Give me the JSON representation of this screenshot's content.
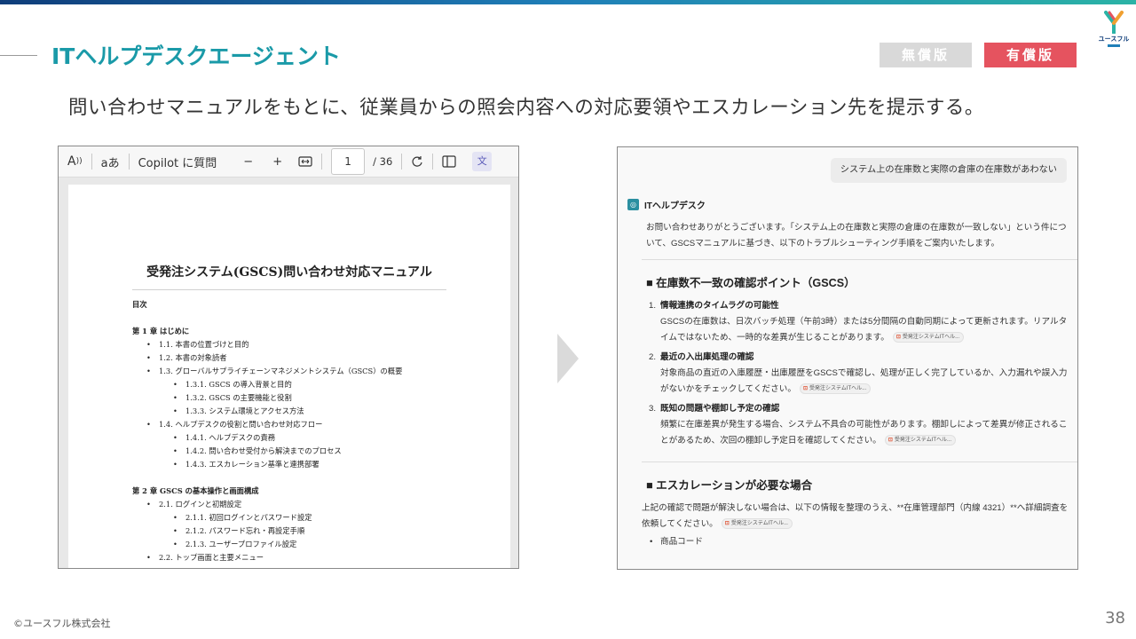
{
  "slide": {
    "title": "ITヘルプデスクエージェント",
    "subtitle": "問い合わせマニュアルをもとに、従業員からの照会内容への対応要領やエスカレーション先を提示する。",
    "badges": {
      "free": "無償版",
      "paid": "有償版"
    },
    "logo_text": "ユースフル",
    "copyright": "©ユースフル株式会社",
    "page_number": "38"
  },
  "pdf_viewer": {
    "toolbar": {
      "read_aloud_label": "A",
      "text_label": "aあ",
      "copilot_label": "Copilot に質問",
      "zoom_out_label": "−",
      "zoom_in_label": "+",
      "current_page": "1",
      "total_pages": "/ 36"
    },
    "document": {
      "title": "受発注システム(GSCS)問い合わせ対応マニュアル",
      "toc_heading": "目次",
      "chapter1": "第 1 章 はじめに",
      "c1_1": "1.1. 本書の位置づけと目的",
      "c1_2": "1.2. 本書の対象読者",
      "c1_3": "1.3. グローバルサプライチェーンマネジメントシステム（GSCS）の概要",
      "c1_3_1": "1.3.1. GSCS の導入背景と目的",
      "c1_3_2": "1.3.2. GSCS の主要機能と役割",
      "c1_3_3": "1.3.3. システム環境とアクセス方法",
      "c1_4": "1.4. ヘルプデスクの役割と問い合わせ対応フロー",
      "c1_4_1": "1.4.1. ヘルプデスクの責務",
      "c1_4_2": "1.4.2. 問い合わせ受付から解決までのプロセス",
      "c1_4_3": "1.4.3. エスカレーション基準と連携部署",
      "chapter2": "第 2 章 GSCS の基本操作と画面構成",
      "c2_1": "2.1. ログインと初期設定",
      "c2_1_1": "2.1.1. 初回ログインとパスワード設定",
      "c2_1_2": "2.1.2. パスワード忘れ・再設定手順",
      "c2_1_3": "2.1.3. ユーザープロファイル設定",
      "c2_2": "2.2. トップ画面と主要メニュー"
    }
  },
  "chat": {
    "user_message": "システム上の在庫数と実際の倉庫の在庫数があわない",
    "bot_name": "ITヘルプデスク",
    "intro": "お問い合わせありがとうございます。「システム上の在庫数と実際の倉庫の在庫数が一致しない」という件について、GSCSマニュアルに基づき、以下のトラブルシューティング手順をご案内いたします。",
    "section1_heading": "■ 在庫数不一致の確認ポイント（GSCS）",
    "items": [
      {
        "num": "1.",
        "title": "情報連携のタイムラグの可能性",
        "body": "GSCSの在庫数は、日次バッチ処理（午前3時）または5分間隔の自動同期によって更新されます。リアルタイムではないため、一時的な差異が生じることがあります。"
      },
      {
        "num": "2.",
        "title": "最近の入出庫処理の確認",
        "body": "対象商品の直近の入庫履歴・出庫履歴をGSCSで確認し、処理が正しく完了しているか、入力漏れや誤入力がないかをチェックしてください。"
      },
      {
        "num": "3.",
        "title": "既知の問題や棚卸し予定の確認",
        "body": "頻繁に在庫差異が発生する場合、システム不具合の可能性があります。棚卸しによって差異が修正されることがあるため、次回の棚卸し予定日を確認してください。"
      }
    ],
    "section2_heading": "■ エスカレーションが必要な場合",
    "escalation_text": "上記の確認で問題が解決しない場合は、以下の情報を整理のうえ、**在庫管理部門（内線 4321）**へ詳細調査を依頼してください。",
    "reference_label": "受発注システムITヘル...",
    "bullet_first": "商品コード"
  },
  "colors": {
    "accent": "#1a9aa8",
    "paid_badge": "#e5535f",
    "free_badge": "#d9d9d9"
  }
}
